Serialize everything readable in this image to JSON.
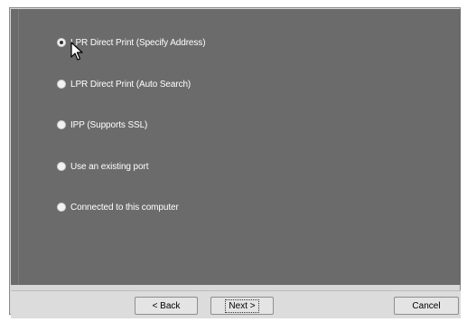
{
  "options": [
    {
      "label": "LPR Direct Print (Specify Address)",
      "selected": true
    },
    {
      "label": "LPR Direct Print (Auto Search)",
      "selected": false
    },
    {
      "label": "IPP (Supports SSL)",
      "selected": false
    },
    {
      "label": "Use an existing port",
      "selected": false
    },
    {
      "label": "Connected to this computer",
      "selected": false
    }
  ],
  "buttons": {
    "back_label": "< Back",
    "next_label": "Next >",
    "cancel_label": "Cancel"
  },
  "colors": {
    "content_bg": "#6b6b6b",
    "option_text": "#ffffff",
    "button_bar_bg": "#dcdcdc"
  }
}
